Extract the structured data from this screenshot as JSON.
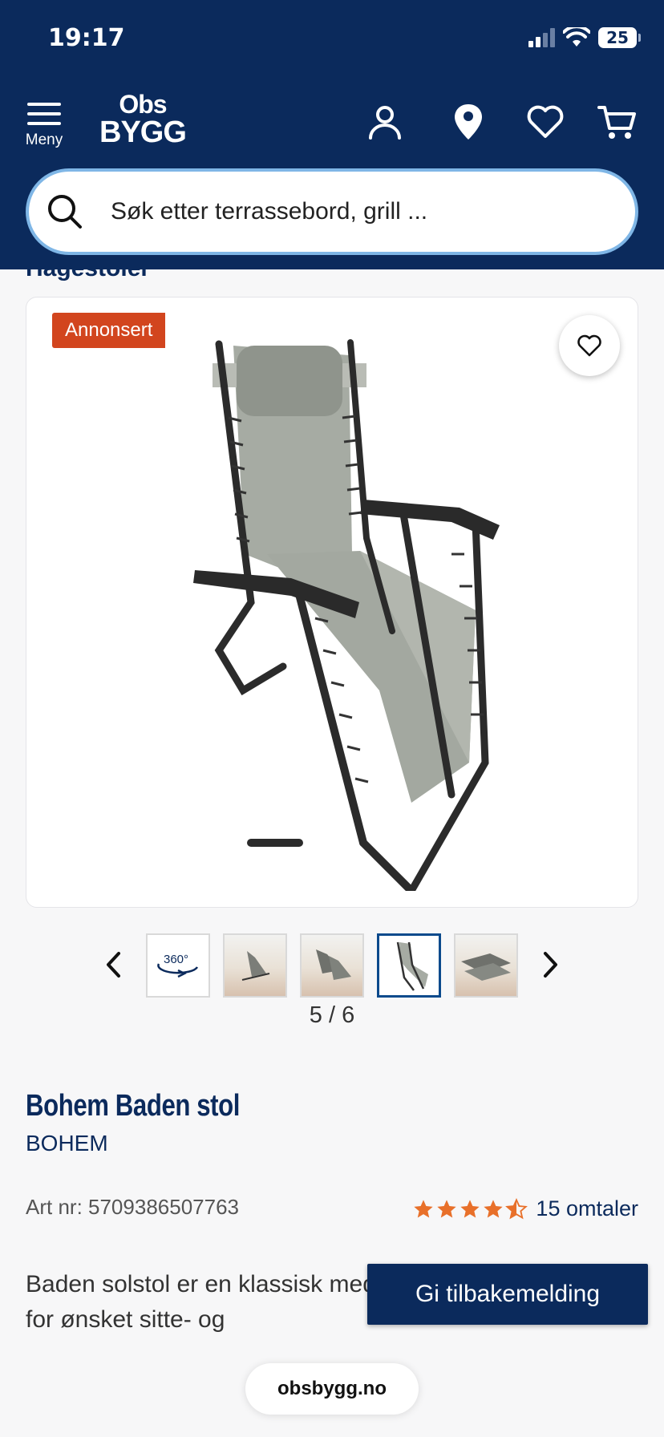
{
  "status_bar": {
    "time": "19:17",
    "battery": "25"
  },
  "header": {
    "menu_label": "Meny",
    "logo_line1": "Obs",
    "logo_line2": "BYGG",
    "icons": [
      "account-icon",
      "location-pin-icon",
      "heart-icon",
      "cart-icon"
    ]
  },
  "search": {
    "placeholder": "Søk etter terrassebord, grill ..."
  },
  "breadcrumb_peek": "Hagestoler",
  "product_image": {
    "badge": "Annonsert",
    "thumbnails": [
      "360°",
      "chair-on-beach",
      "chairs-on-beach",
      "chair-front",
      "chairs-lying"
    ],
    "active_thumbnail_index": 3,
    "pager": "5 / 6"
  },
  "product": {
    "title": "Bohem Baden stol",
    "brand": "BOHEM",
    "art_nr": "Art nr: 5709386507763",
    "rating": 4.5,
    "reviews_label": "15 omtaler",
    "description": "Baden solstol er en klassisk med trinnløs låsefunksjon for ønsket sitte- og"
  },
  "feedback_button": "Gi tilbakemelding",
  "browser_url": "obsbygg.no",
  "colors": {
    "brand_navy": "#0b2a5c",
    "badge_orange": "#d2451e",
    "star_orange": "#e8702a",
    "search_border": "#7fb6e6"
  }
}
